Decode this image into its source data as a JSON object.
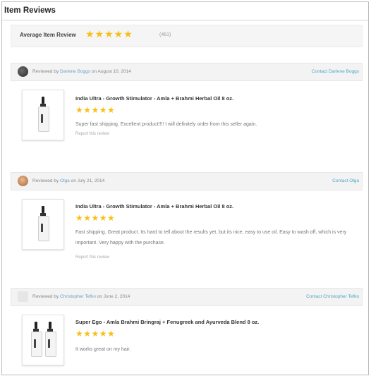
{
  "header": {
    "title": "Item Reviews"
  },
  "average": {
    "label": "Average Item Review",
    "stars": "★★★★★",
    "count": "(461)"
  },
  "reviews": [
    {
      "by_prefix": "Reviewed by",
      "name": "Darlene Boggs",
      "date": "on August 10, 2014",
      "contact": "Contact Darlene Boggs",
      "product": "India Ultra - Growth Stimulator - Amla + Brahmi Herbal Oil 8 oz.",
      "stars": "★★★★★",
      "text": "Super fast shipping. Excellent product!!!! I will definitely order from this seller again.",
      "helpful": "Report this review"
    },
    {
      "by_prefix": "Reviewed by",
      "name": "Olga",
      "date": "on July 21, 2014",
      "contact": "Contact Olga",
      "product": "India Ultra - Growth Stimulator - Amla + Brahmi Herbal Oil 8 oz.",
      "stars": "★★★★★",
      "text": "Fast shipping. Great product. Its hard to tell about the results yet, but its nice, easy to use oil. Easy to wash off, which is very important. Very happy with the purchase.",
      "helpful": "Report this review"
    },
    {
      "by_prefix": "Reviewed by",
      "name": "Christopher Tefko",
      "date": "on June 2, 2014",
      "contact": "Contact Christopher Tefko",
      "product": "Super Ego - Amla Brahmi Bringraj + Fenugreek and Ayurveda Blend 8 oz.",
      "stars": "★★★★★",
      "text": "It works great on my hair.",
      "helpful": ""
    }
  ],
  "colors": {
    "star": "#f5c118",
    "link": "#4fa6c8"
  }
}
